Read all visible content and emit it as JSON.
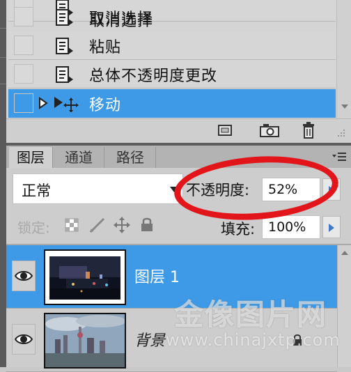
{
  "history": {
    "items": [
      {
        "label": "取消选择",
        "selected": false
      },
      {
        "label": "粘贴",
        "selected": false
      },
      {
        "label": "总体不透明度更改",
        "selected": false
      },
      {
        "label": "移动",
        "selected": true
      }
    ],
    "footer_icons": [
      "new-document-from-state-icon",
      "camera-snapshot-icon",
      "trash-icon"
    ]
  },
  "layers_panel": {
    "tabs": [
      {
        "label": "图层",
        "active": true
      },
      {
        "label": "通道",
        "active": false
      },
      {
        "label": "路径",
        "active": false
      }
    ],
    "blend_mode": "正常",
    "opacity_label": "不透明度:",
    "opacity_value": "52%",
    "lock_label": "锁定:",
    "fill_label": "填充:",
    "fill_value": "100%",
    "layers": [
      {
        "name": "图层 1",
        "selected": true,
        "visible": true
      },
      {
        "name": "背景",
        "selected": false,
        "visible": true,
        "locked": true
      }
    ]
  },
  "watermark": {
    "cn": "金像图片网",
    "en": "www.chinajxtp.com"
  },
  "colors": {
    "selection": "#3e9ae6",
    "highlight_ring": "#e2151b",
    "stepper_arrow": "#3e7ac8"
  }
}
